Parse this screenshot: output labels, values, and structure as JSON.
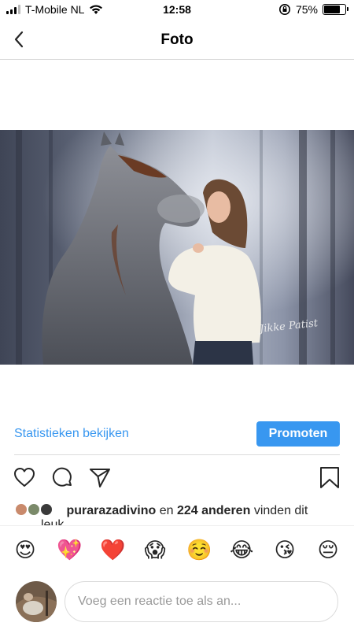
{
  "status_bar": {
    "carrier": "T-Mobile NL",
    "time": "12:58",
    "battery_percent": "75%",
    "battery_level": 0.75,
    "icons": [
      "signal-icon",
      "wifi-icon",
      "orientation-lock-icon",
      "battery-icon"
    ]
  },
  "nav": {
    "title": "Foto",
    "back_icon": "chevron-left-icon"
  },
  "photo": {
    "signature": "Jikke Patist"
  },
  "actions": {
    "stats_link": "Statistieken bekijken",
    "promote": "Promoten",
    "accent_color": "#3897f0",
    "icons": [
      "heart-icon",
      "comment-icon",
      "share-icon",
      "bookmark-icon"
    ]
  },
  "likes": {
    "user": "purarazadivino",
    "joiner": "en",
    "others": "224 anderen",
    "suffix": "vinden dit",
    "suffix2": "leuk"
  },
  "emoji_bar": {
    "items": [
      "😍",
      "💖",
      "❤️",
      "😱",
      "☺️",
      "😂",
      "😘",
      "😔"
    ]
  },
  "comment": {
    "placeholder": "Voeg een reactie toe als an..."
  }
}
